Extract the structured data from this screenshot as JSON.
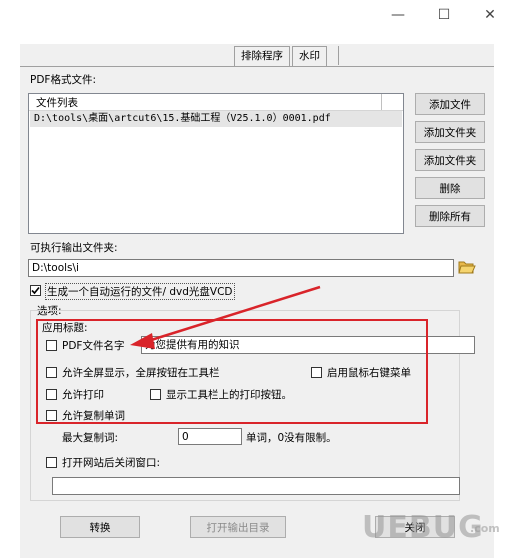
{
  "window": {
    "minimize_glyph": "—",
    "maximize_glyph": "☐",
    "close_glyph": "✕"
  },
  "tabs": [
    {
      "label": "排除程序"
    },
    {
      "label": "水印"
    }
  ],
  "pdf_section": {
    "label": "PDF格式文件:",
    "list_header": "文件列表",
    "files": [
      "D:\\tools\\桌面\\artcut6\\15.基础工程（V25.1.0）0001.pdf"
    ]
  },
  "buttons": {
    "add_file": "添加文件",
    "add_folder_1": "添加文件夹",
    "add_folder_2": "添加文件夹",
    "delete": "删除",
    "delete_all": "删除所有",
    "convert": "转换",
    "open_output": "打开输出目录",
    "close": "关闭"
  },
  "output": {
    "label": "可执行输出文件夹:",
    "path": "D:\\tools\\i",
    "folder_icon": "folder-open-icon"
  },
  "autorun": {
    "label": "生成一个自动运行的文件/ dvd光盘VCD",
    "checked": true
  },
  "options": {
    "group_label": "选项:",
    "app_title_label": "应用标题:",
    "pdf_filename_label": "PDF文件名字",
    "pdf_filename_value": "为您提供有用的知识",
    "fullscreen_label": "允许全屏显示，全屏按钮在工具栏",
    "mouse_right_label": "启用鼠标右键菜单",
    "allow_print_label": "允许打印",
    "show_print_label": "显示工具栏上的打印按钮。",
    "allow_copy_label": "允许复制单词",
    "max_copy_label": "最大复制词:",
    "max_copy_value": "0",
    "max_copy_suffix": "单词，0没有限制。",
    "close_window_label": "打开网站后关闭窗口:"
  },
  "watermark": {
    "text": "UEBUG",
    "sub": ".com"
  },
  "colors": {
    "highlight_red": "#d9242a"
  }
}
